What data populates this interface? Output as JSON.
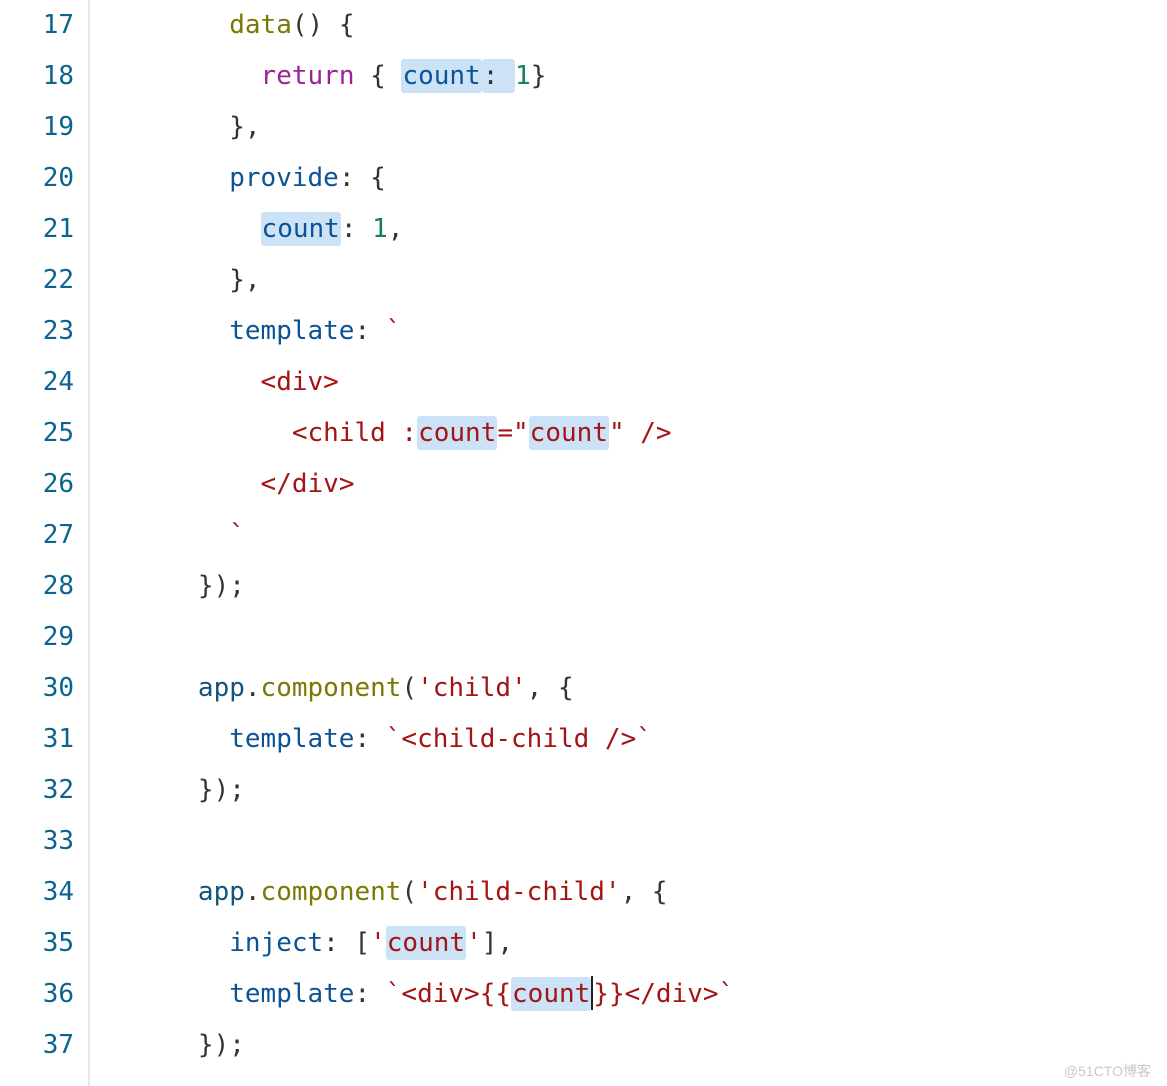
{
  "gutter": {
    "start": 17,
    "end": 37
  },
  "code": {
    "lines": [
      {
        "n": 17,
        "indent": 4,
        "tokens": [
          {
            "t": "data",
            "c": "tok-fn"
          },
          {
            "t": "() {",
            "c": ""
          }
        ]
      },
      {
        "n": 18,
        "indent": 5,
        "tokens": [
          {
            "t": "return",
            "c": "tok-kw"
          },
          {
            "t": " { ",
            "c": ""
          },
          {
            "t": "count",
            "c": "tok-prop",
            "hl": true
          },
          {
            "t": ": ",
            "c": "",
            "hl": true
          },
          {
            "t": "1",
            "c": "tok-num"
          },
          {
            "t": "}",
            "c": ""
          }
        ]
      },
      {
        "n": 19,
        "indent": 4,
        "tokens": [
          {
            "t": "},",
            "c": ""
          }
        ]
      },
      {
        "n": 20,
        "indent": 4,
        "tokens": [
          {
            "t": "provide",
            "c": "tok-prop"
          },
          {
            "t": ": {",
            "c": ""
          }
        ]
      },
      {
        "n": 21,
        "indent": 5,
        "tokens": [
          {
            "t": "count",
            "c": "tok-prop",
            "hl": true
          },
          {
            "t": ": ",
            "c": ""
          },
          {
            "t": "1",
            "c": "tok-num"
          },
          {
            "t": ",",
            "c": ""
          }
        ]
      },
      {
        "n": 22,
        "indent": 4,
        "tokens": [
          {
            "t": "},",
            "c": ""
          }
        ]
      },
      {
        "n": 23,
        "indent": 4,
        "tokens": [
          {
            "t": "template",
            "c": "tok-prop"
          },
          {
            "t": ": ",
            "c": ""
          },
          {
            "t": "`",
            "c": "tok-str"
          }
        ]
      },
      {
        "n": 24,
        "indent": 5,
        "tokens": [
          {
            "t": "<div>",
            "c": "tok-tag"
          }
        ]
      },
      {
        "n": 25,
        "indent": 6,
        "tokens": [
          {
            "t": "<child :",
            "c": "tok-tag"
          },
          {
            "t": "count",
            "c": "tok-tag",
            "hl": true
          },
          {
            "t": "=\"",
            "c": "tok-tag"
          },
          {
            "t": "count",
            "c": "tok-tag",
            "hl": true
          },
          {
            "t": "\" />",
            "c": "tok-tag"
          }
        ]
      },
      {
        "n": 26,
        "indent": 5,
        "tokens": [
          {
            "t": "</div>",
            "c": "tok-tag"
          }
        ]
      },
      {
        "n": 27,
        "indent": 4,
        "tokens": [
          {
            "t": "`",
            "c": "tok-str"
          }
        ]
      },
      {
        "n": 28,
        "indent": 3,
        "tokens": [
          {
            "t": "});",
            "c": ""
          }
        ]
      },
      {
        "n": 29,
        "indent": 0,
        "tokens": []
      },
      {
        "n": 30,
        "indent": 3,
        "tokens": [
          {
            "t": "app",
            "c": "tok-obj"
          },
          {
            "t": ".",
            "c": ""
          },
          {
            "t": "component",
            "c": "tok-fn"
          },
          {
            "t": "(",
            "c": ""
          },
          {
            "t": "'child'",
            "c": "tok-str"
          },
          {
            "t": ", {",
            "c": ""
          }
        ]
      },
      {
        "n": 31,
        "indent": 4,
        "tokens": [
          {
            "t": "template",
            "c": "tok-prop"
          },
          {
            "t": ": ",
            "c": ""
          },
          {
            "t": "`<child-child />`",
            "c": "tok-str"
          }
        ]
      },
      {
        "n": 32,
        "indent": 3,
        "tokens": [
          {
            "t": "});",
            "c": ""
          }
        ]
      },
      {
        "n": 33,
        "indent": 0,
        "tokens": []
      },
      {
        "n": 34,
        "indent": 3,
        "tokens": [
          {
            "t": "app",
            "c": "tok-obj"
          },
          {
            "t": ".",
            "c": ""
          },
          {
            "t": "component",
            "c": "tok-fn"
          },
          {
            "t": "(",
            "c": ""
          },
          {
            "t": "'child-child'",
            "c": "tok-str"
          },
          {
            "t": ", {",
            "c": ""
          }
        ]
      },
      {
        "n": 35,
        "indent": 4,
        "tokens": [
          {
            "t": "inject",
            "c": "tok-prop"
          },
          {
            "t": ": [",
            "c": ""
          },
          {
            "t": "'",
            "c": "tok-str"
          },
          {
            "t": "count",
            "c": "tok-str",
            "hl": true
          },
          {
            "t": "'",
            "c": "tok-str"
          },
          {
            "t": "],",
            "c": ""
          }
        ]
      },
      {
        "n": 36,
        "indent": 4,
        "tokens": [
          {
            "t": "template",
            "c": "tok-prop"
          },
          {
            "t": ": ",
            "c": ""
          },
          {
            "t": "`<div>{{",
            "c": "tok-str"
          },
          {
            "t": "count",
            "c": "tok-str",
            "hl": true,
            "cursorAfter": true
          },
          {
            "t": "}}</div>`",
            "c": "tok-str"
          }
        ]
      },
      {
        "n": 37,
        "indent": 3,
        "tokens": [
          {
            "t": "});",
            "c": ""
          }
        ]
      }
    ]
  },
  "watermark": "@51CTO博客"
}
